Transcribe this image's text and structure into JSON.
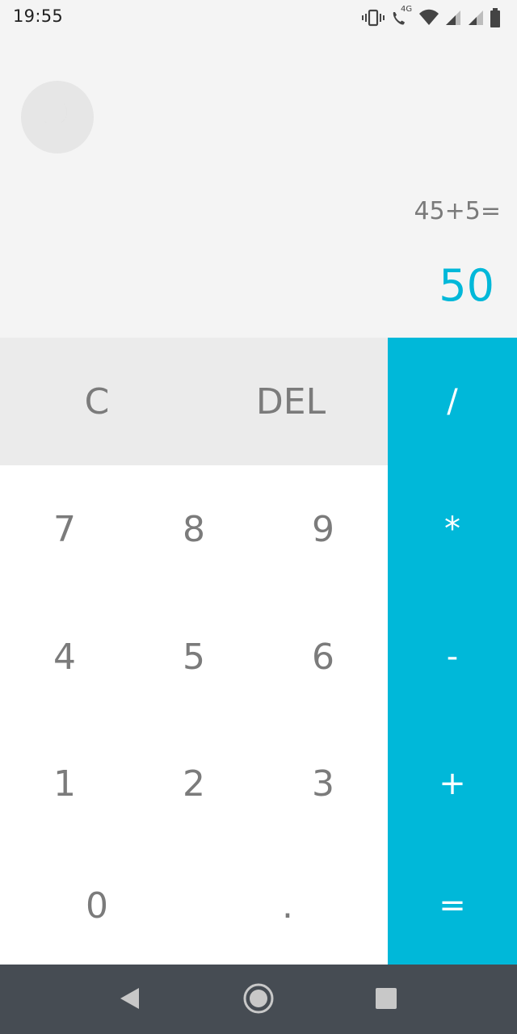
{
  "status_bar": {
    "time": "19:55",
    "network_label": "4G",
    "icons": [
      "vibrate-icon",
      "call-4g-icon",
      "wifi-icon",
      "signal-icon",
      "signal-icon",
      "battery-icon"
    ]
  },
  "display": {
    "theme_icon": "moon-icon",
    "expression": "45+5=",
    "result": "50",
    "accent_color": "#00b8d9"
  },
  "keypad": {
    "function_keys": {
      "clear": "C",
      "delete": "DEL"
    },
    "digits": {
      "seven": "7",
      "eight": "8",
      "nine": "9",
      "four": "4",
      "five": "5",
      "six": "6",
      "one": "1",
      "two": "2",
      "three": "3",
      "zero": "0",
      "decimal": "."
    },
    "operators": {
      "divide": "/",
      "multiply": "*",
      "subtract": "-",
      "add": "+",
      "equals": "="
    }
  },
  "navigation": {
    "buttons": [
      "back-icon",
      "home-icon",
      "recents-icon"
    ]
  }
}
